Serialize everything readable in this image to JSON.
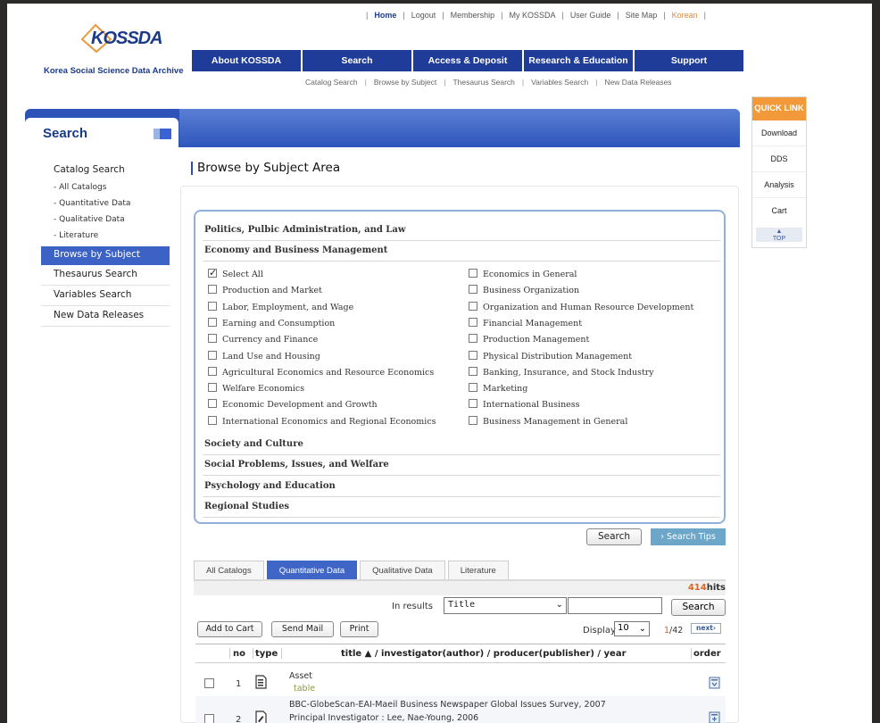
{
  "utility_nav": [
    "Home",
    "Logout",
    "Membership",
    "My KOSSDA",
    "User Guide",
    "Site Map",
    "Korean"
  ],
  "logo": {
    "name": "KOSSDA",
    "subtitle": "Korea Social Science Data Archive"
  },
  "main_nav": [
    "About KOSSDA",
    "Search",
    "Access & Deposit",
    "Research & Education",
    "Support"
  ],
  "sub_nav": [
    "Catalog Search",
    "Browse by Subject",
    "Thesaurus Search",
    "Variables Search",
    "New Data Releases"
  ],
  "quick_link": {
    "title": "QUICK LINK",
    "items": [
      "Download",
      "DDS",
      "Analysis",
      "Cart"
    ],
    "top": {
      "arrow": "▲",
      "label": "TOP"
    }
  },
  "sidebar": {
    "title": "Search",
    "catalog_search": "Catalog Search",
    "catalog_sub": [
      "- All Catalogs",
      "- Quantitative Data",
      "- Qualitative Data",
      "- Literature"
    ],
    "items": [
      "Browse by Subject",
      "Thesaurus Search",
      "Variables Search",
      "New Data Releases"
    ]
  },
  "content_title": "Browse by Subject Area",
  "subjects": {
    "top_categories": [
      "Politics, Pulbic Administration, and Law",
      "Economy and Business Management"
    ],
    "options_left": [
      {
        "label": "Select All",
        "checked": true
      },
      {
        "label": "Production and Market",
        "checked": false
      },
      {
        "label": "Labor, Employment, and Wage",
        "checked": false
      },
      {
        "label": "Earning and Consumption",
        "checked": false
      },
      {
        "label": "Currency and Finance",
        "checked": false
      },
      {
        "label": "Land Use and Housing",
        "checked": false
      },
      {
        "label": "Agricultural Economics and Resource Economics",
        "checked": false
      },
      {
        "label": "Welfare Economics",
        "checked": false
      },
      {
        "label": "Economic Development and Growth",
        "checked": false
      },
      {
        "label": "International Economics and Regional Economics",
        "checked": false
      }
    ],
    "options_right": [
      {
        "label": "Economics in General",
        "checked": false
      },
      {
        "label": "Business Organization",
        "checked": false
      },
      {
        "label": "Organization and Human Resource Development",
        "checked": false
      },
      {
        "label": "Financial Management",
        "checked": false
      },
      {
        "label": "Production Management",
        "checked": false
      },
      {
        "label": "Physical Distribution Management",
        "checked": false
      },
      {
        "label": "Banking, Insurance, and Stock Industry",
        "checked": false
      },
      {
        "label": "Marketing",
        "checked": false
      },
      {
        "label": "International Business",
        "checked": false
      },
      {
        "label": "Business Management in General",
        "checked": false
      }
    ],
    "bottom_categories": [
      "Society and Culture",
      "Social Problems, Issues, and Welfare",
      "Psychology and Education",
      "Regional Studies"
    ]
  },
  "buttons": {
    "search": "Search",
    "search_tips": "› Search Tips"
  },
  "tabs": [
    {
      "label": "All Catalogs",
      "active": false
    },
    {
      "label": "Quantitative Data",
      "active": true
    },
    {
      "label": "Qualitative Data",
      "active": false
    },
    {
      "label": "Literature",
      "active": false
    }
  ],
  "results": {
    "hits_count": "414",
    "hits_label": "hits",
    "in_results_label": "In results",
    "field_select": "Title",
    "query": "",
    "search_button": "Search",
    "actions": [
      "Add to Cart",
      "Send Mail",
      "Print"
    ],
    "display_label": "Display",
    "display_value": "10",
    "page_current": "1",
    "page_total": "/42",
    "next": "next›",
    "columns": {
      "no": "no",
      "type": "type",
      "title": "title ▲ / investigator(author) / producer(publisher) / year",
      "order": "order"
    },
    "rows": [
      {
        "no": "1",
        "title": "Asset",
        "sub": "table",
        "type_icon": "document-icon"
      },
      {
        "no": "2",
        "title": "BBC-GlobeScan-EAI-Maeil Business Newspaper Global Issues Survey, 2007",
        "sub": "Principal Investigator : Lee, Nae-Young, 2006",
        "type_icon": "document-edit-icon"
      }
    ]
  },
  "colors": {
    "nav_blue": "#1f3c99",
    "accent_orange": "#f29a3a",
    "active_blue": "#3b62c4",
    "hits_orange": "#e0641e"
  }
}
